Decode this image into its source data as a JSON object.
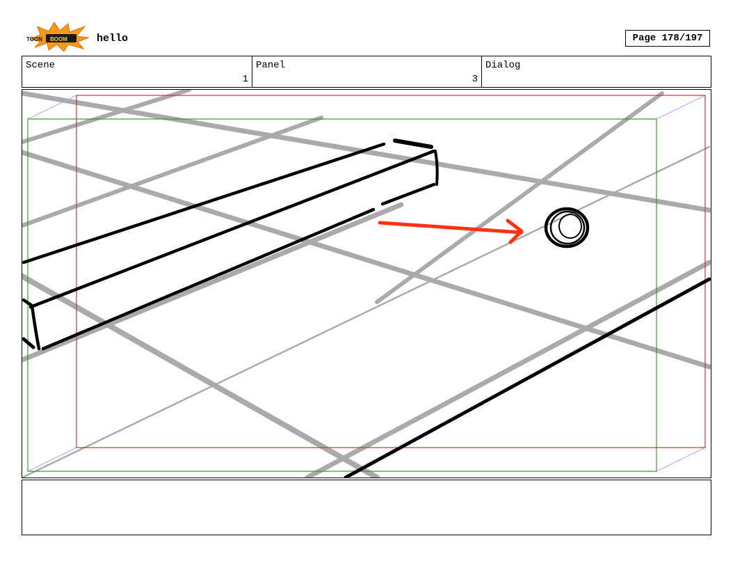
{
  "header": {
    "logo_text_left": "TOON",
    "logo_text_right": "BOOM",
    "project_title": "hello",
    "page_label": "Page 178/197"
  },
  "fields": {
    "scene_label": "Scene",
    "scene_value": "1",
    "panel_label": "Panel",
    "panel_value": "3",
    "dialog_label": "Dialog",
    "dialog_value": ""
  },
  "panel": {
    "camera_frame_color": "#cc3333",
    "safe_frame_color": "#339933",
    "arrow_color": "#ff3311",
    "guide_line_color": "#aaaaaa",
    "projection_line_color": "#aaaaff"
  },
  "notes": {
    "text": ""
  }
}
